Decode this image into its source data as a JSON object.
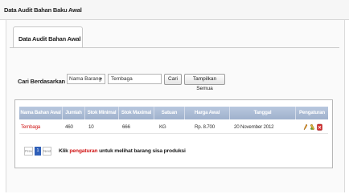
{
  "window": {
    "title": "Data Audit Bahan Baku Awal"
  },
  "tabs": [
    {
      "label": "Data Audit Bahan Awal"
    }
  ],
  "search": {
    "label": "Cari Berdasarkan :",
    "field_select": "Nama Barang",
    "query": "Tembaga",
    "search_button": "Cari",
    "show_all_button": "Tampilkan Semua"
  },
  "table": {
    "columns": [
      "Nama Bahan Awal",
      "Jumlah",
      "Stok Minimal",
      "Stok Maximal",
      "Satuan",
      "Harga Awal",
      "Tanggal",
      "Pengaturan"
    ],
    "rows": [
      {
        "nama": "Tembaga",
        "jumlah": "460",
        "stok_min": "10",
        "stok_max": "666",
        "satuan": "KG",
        "harga": "Rp. 8.700",
        "tanggal": "20 November 2012"
      }
    ],
    "row_actions": [
      "edit-icon",
      "settings-icon",
      "delete-icon"
    ]
  },
  "pager": {
    "prev": "Prev",
    "page": "1",
    "next": "Next"
  },
  "footer_note": {
    "prefix": "Klik ",
    "link": "pengaturan",
    "suffix": " untuk melihat barang sisa produksi"
  },
  "colors": {
    "header": "#a9bad4",
    "link": "#d01818",
    "active_page": "#2f5fb8"
  }
}
